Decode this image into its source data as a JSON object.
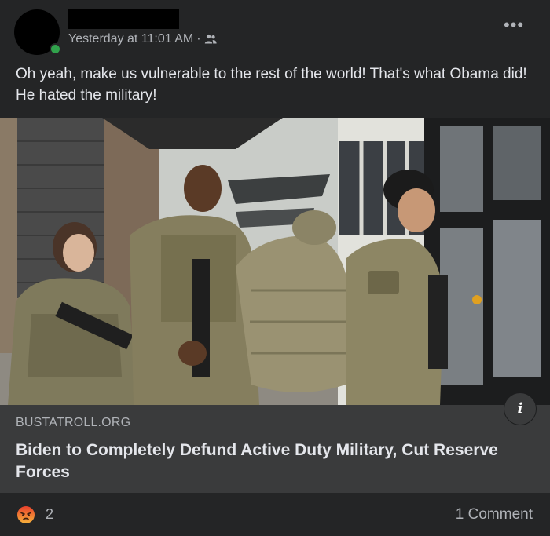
{
  "header": {
    "timestamp": "Yesterday at 11:01 AM",
    "separator": "·",
    "audience_icon": "friends-icon",
    "more_label": "•••"
  },
  "post": {
    "text": "Oh yeah, make us vulnerable to the rest of the world! That's what Obama did! He hated the military!"
  },
  "link": {
    "domain": "BUSTATROLL.ORG",
    "headline": "Biden to Completely Defund Active Duty Military, Cut Reserve Forces",
    "info_label": "i"
  },
  "footer": {
    "reaction_icon": "angry-reaction-icon",
    "reaction_count": "2",
    "comment_count": "1 Comment"
  },
  "colors": {
    "background": "#242526",
    "link_box": "#3a3b3c",
    "text_primary": "#e4e6eb",
    "text_secondary": "#b0b3b8",
    "angry": "#f0a03c"
  }
}
